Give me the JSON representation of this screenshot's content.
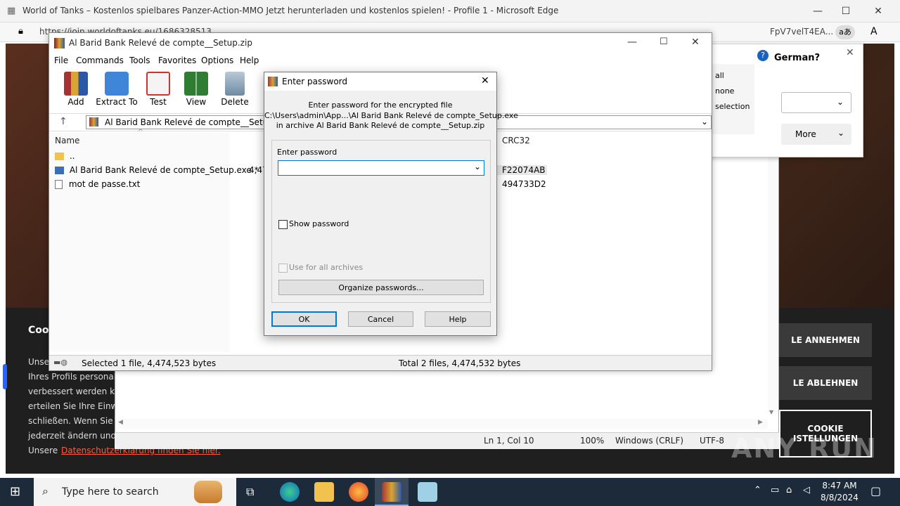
{
  "edge": {
    "title": "World of Tanks – Kostenlos spielbares Panzer-Action-MMO Jetzt herunterladen und kostenlos spielen! - Profile 1 - Microsoft Edge",
    "url": "https://join.worldoftanks.eu/1686328513",
    "url_tail": "FpV7velT4EA...",
    "read_aloud_label": "aあ"
  },
  "translate_popup": {
    "question": "German?",
    "more_label": "More"
  },
  "cookie": {
    "title": "Cool",
    "lines": [
      "Unse",
      "Ihres Profils personalisi",
      "verbessert werden kan",
      "erteilen Sie Ihre Einwil",
      "schließen. Wenn Sie a",
      "jederzeit ändern und w",
      "Unsere"
    ],
    "link": "Datenschutzerklärung finden Sie hier.",
    "accept": "LE ANNEHMEN",
    "reject": "LE ABLEHNEN",
    "settings_line1": "COOKIE",
    "settings_line2": "ISTELLUNGEN"
  },
  "notepad": {
    "position": "Ln 1, Col 10",
    "zoom": "100%",
    "line_ending": "Windows (CRLF)",
    "encoding": "UTF-8",
    "side_labels": [
      "all",
      "none",
      "selection"
    ]
  },
  "winrar": {
    "title": "Al Barid Bank Relevé de compte__Setup.zip",
    "menu": [
      "File",
      "Commands",
      "Tools",
      "Favorites",
      "Options",
      "Help"
    ],
    "toolbar": [
      "Add",
      "Extract To",
      "Test",
      "View",
      "Delete"
    ],
    "path": "Al Barid Bank Relevé de compte__Setup.zip",
    "columns": {
      "name": "Name",
      "crc": "CRC32"
    },
    "files": [
      {
        "name": "..",
        "size": "",
        "crc": ""
      },
      {
        "name": "Al Barid Bank Relevé de compte_Setup.exe *",
        "size": "4,474",
        "crc": "F22074AB"
      },
      {
        "name": "mot de passe.txt",
        "size": "",
        "crc": "494733D2"
      }
    ],
    "status_left": "Selected 1 file, 4,474,523 bytes",
    "status_right": "Total 2 files, 4,474,532 bytes"
  },
  "password_dialog": {
    "title": "Enter password",
    "info_line1": "Enter password for the encrypted file",
    "info_line2": "C:\\Users\\admin\\App...\\Al Barid Bank Relevé de compte_Setup.exe",
    "info_line3": "in archive Al Barid Bank Relevé de compte__Setup.zip",
    "field_label": "Enter password",
    "field_value": "",
    "show_password": "Show password",
    "use_for_all": "Use for all archives",
    "organize": "Organize passwords...",
    "ok": "OK",
    "cancel": "Cancel",
    "help": "Help"
  },
  "taskbar": {
    "search_placeholder": "Type here to search",
    "time": "8:47 AM",
    "date": "8/8/2024"
  },
  "watermark": "ANY RUN"
}
